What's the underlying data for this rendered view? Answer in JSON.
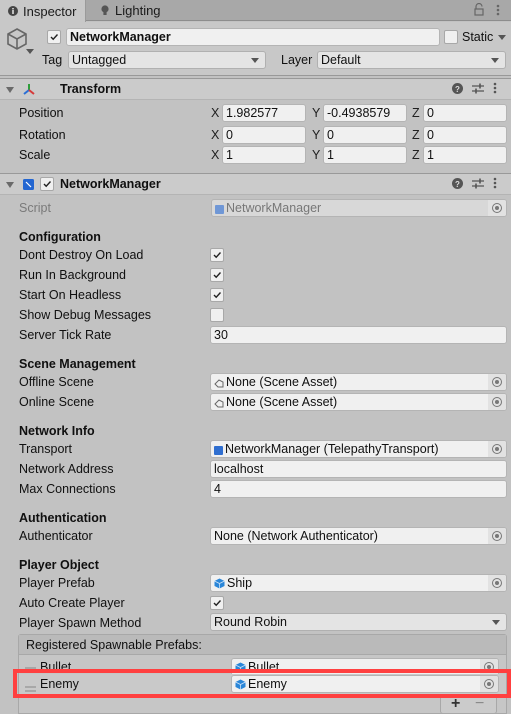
{
  "tabs": [
    {
      "label": "Inspector",
      "icon": "info-icon",
      "active": true
    },
    {
      "label": "Lighting",
      "icon": "lightbulb-icon",
      "active": false
    }
  ],
  "window_icons": [
    "lock-icon",
    "kebab-menu-icon"
  ],
  "gameobject": {
    "active": true,
    "name": "NetworkManager",
    "static_label": "Static",
    "static": false,
    "tag_label": "Tag",
    "tag": "Untagged",
    "layer_label": "Layer",
    "layer": "Default"
  },
  "transform": {
    "title": "Transform",
    "rows": [
      {
        "label": "Position",
        "x": "1.982577",
        "y": "-0.4938579",
        "z": "0"
      },
      {
        "label": "Rotation",
        "x": "0",
        "y": "0",
        "z": "0"
      },
      {
        "label": "Scale",
        "x": "1",
        "y": "1",
        "z": "1"
      }
    ],
    "axis_labels": {
      "x": "X",
      "y": "Y",
      "z": "Z"
    }
  },
  "network_manager": {
    "title": "NetworkManager",
    "enabled": true,
    "script_label": "Script",
    "script_value": "NetworkManager",
    "configuration": {
      "heading": "Configuration",
      "dont_destroy_label": "Dont Destroy On Load",
      "dont_destroy": true,
      "run_bg_label": "Run In Background",
      "run_bg": true,
      "headless_label": "Start On Headless",
      "headless": true,
      "debug_label": "Show Debug Messages",
      "debug": false,
      "tick_label": "Server Tick Rate",
      "tick": "30"
    },
    "scene_management": {
      "heading": "Scene Management",
      "offline_label": "Offline Scene",
      "offline": "None (Scene Asset)",
      "online_label": "Online Scene",
      "online": "None (Scene Asset)"
    },
    "network_info": {
      "heading": "Network Info",
      "transport_label": "Transport",
      "transport": "NetworkManager (TelepathyTransport)",
      "address_label": "Network Address",
      "address": "localhost",
      "maxconn_label": "Max Connections",
      "maxconn": "4"
    },
    "authentication": {
      "heading": "Authentication",
      "auth_label": "Authenticator",
      "auth": "None (Network Authenticator)"
    },
    "player_object": {
      "heading": "Player Object",
      "prefab_label": "Player Prefab",
      "prefab": "Ship",
      "autocreate_label": "Auto Create Player",
      "autocreate": true,
      "spawn_label": "Player Spawn Method",
      "spawn": "Round Robin"
    },
    "spawnables": {
      "heading": "Registered Spawnable Prefabs:",
      "items": [
        {
          "label": "Bullet",
          "value": "Bullet"
        },
        {
          "label": "Enemy",
          "value": "Enemy"
        }
      ],
      "add_label": "+",
      "remove_label": "−"
    }
  },
  "highlight_color": "#ff4040"
}
